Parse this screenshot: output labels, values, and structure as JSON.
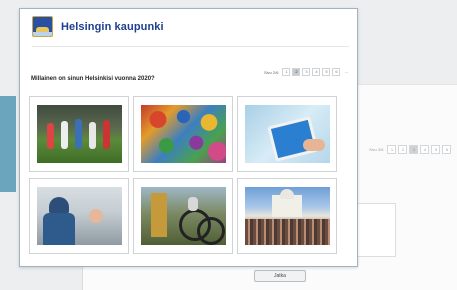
{
  "background": {
    "pager": {
      "label": "Sivu 3/6",
      "pages": [
        "1",
        "2",
        "3",
        "4",
        "5",
        "6"
      ],
      "current": "3"
    },
    "next_button_label": "Jatka"
  },
  "survey": {
    "brand": "Helsingin kaupunki",
    "question": "Millainen on sinun Helsinkisi vuonna 2020?",
    "pager": {
      "label": "Sivu 2/6",
      "pages": [
        "1",
        "2",
        "3",
        "4",
        "5",
        "6"
      ],
      "current": "2",
      "next": "→"
    },
    "image_options": [
      {
        "name": "image-option-sports"
      },
      {
        "name": "image-option-puzzle"
      },
      {
        "name": "image-option-tablet"
      },
      {
        "name": "image-option-child-window"
      },
      {
        "name": "image-option-cyclist"
      },
      {
        "name": "image-option-crowd-cathedral"
      }
    ]
  },
  "colors": {
    "brand": "#1d3f8f",
    "accent": "#6aa5bd"
  }
}
